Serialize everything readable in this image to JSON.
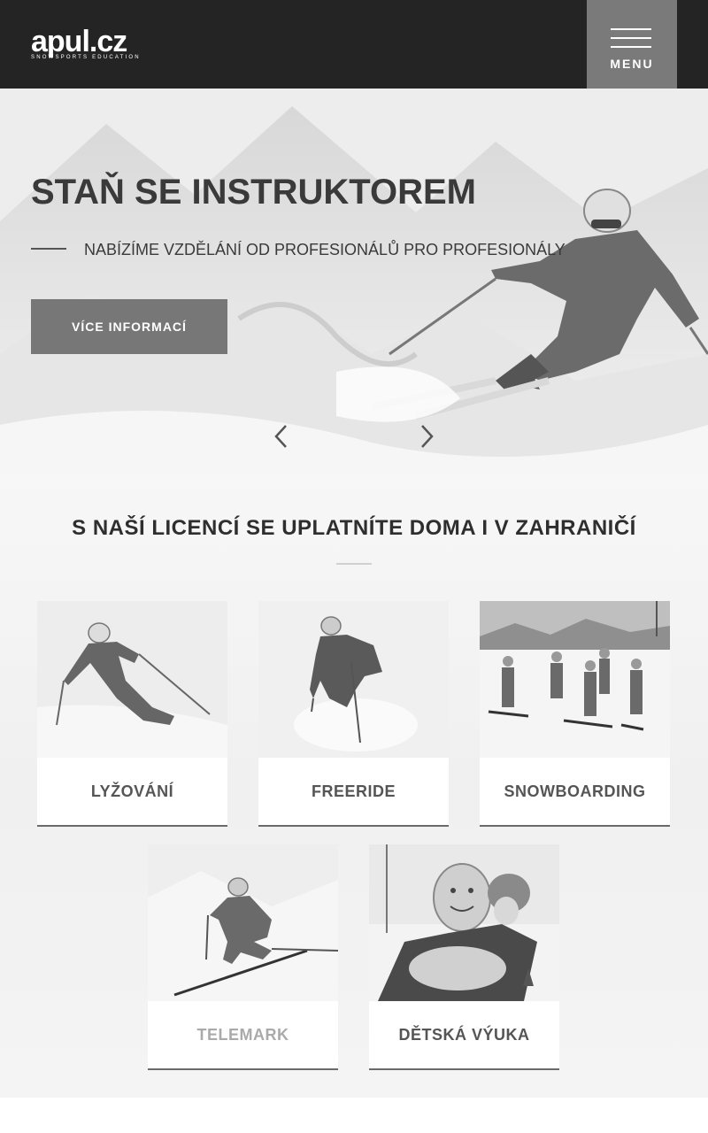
{
  "header": {
    "logo_text": "apul.cz",
    "logo_tagline": "SNOWSPORTS EDUCATION",
    "menu_label": "MENU"
  },
  "hero": {
    "title": "STAŇ SE INSTRUKTOREM",
    "subtitle": "NABÍZÍME VZDĚLÁNÍ OD PROFESIONÁLŮ PRO PROFESIONÁLY",
    "button_label": "VÍCE INFORMACÍ"
  },
  "section": {
    "title": "S NAŠÍ LICENCÍ SE UPLATNÍTE DOMA I V ZAHRANIČÍ"
  },
  "cards": [
    {
      "label": "LYŽOVÁNÍ"
    },
    {
      "label": "FREERIDE"
    },
    {
      "label": "SNOWBOARDING"
    },
    {
      "label": "TELEMARK"
    },
    {
      "label": "DĚTSKÁ VÝUKA"
    }
  ],
  "icons": {
    "menu": "hamburger-icon",
    "prev": "chevron-left-icon",
    "next": "chevron-right-icon"
  }
}
